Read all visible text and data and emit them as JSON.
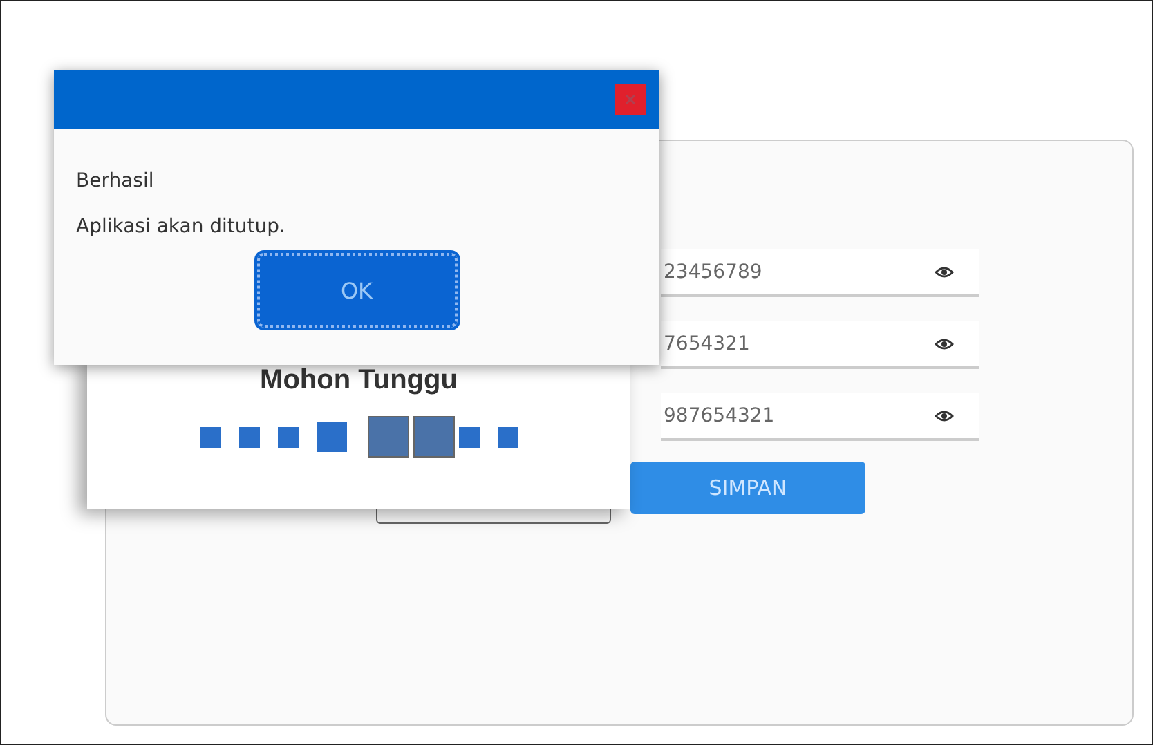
{
  "form": {
    "fields": [
      {
        "value": "23456789"
      },
      {
        "value": "7654321"
      },
      {
        "value": "987654321"
      }
    ],
    "save_button": "SIMPAN"
  },
  "loading_dialog": {
    "title": "Mohon Tunggu",
    "squares": [
      {
        "kind": "small"
      },
      {
        "kind": "small"
      },
      {
        "kind": "small"
      },
      {
        "kind": "medium"
      },
      {
        "kind": "large"
      },
      {
        "kind": "large"
      },
      {
        "kind": "small"
      },
      {
        "kind": "small"
      }
    ]
  },
  "alert_dialog": {
    "heading": "Berhasil",
    "message": "Aplikasi akan ditutup.",
    "button": "OK"
  }
}
